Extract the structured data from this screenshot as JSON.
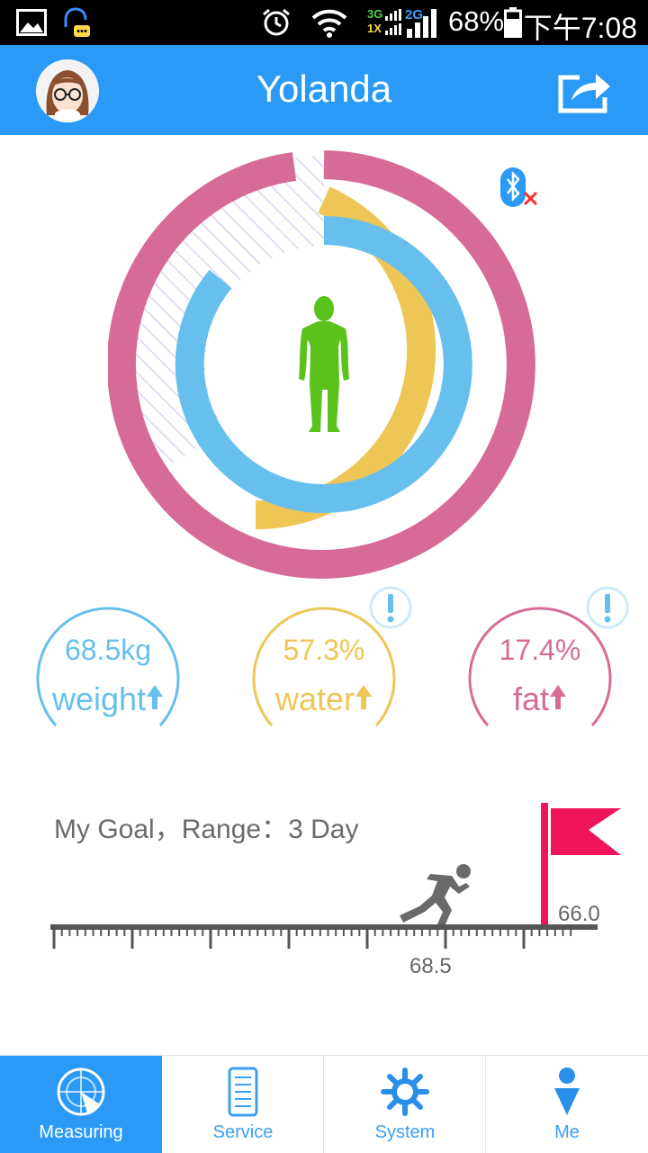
{
  "status_bar": {
    "battery": "68%",
    "time": "下午7:08",
    "network_3g": "3G",
    "network_1x": "1X",
    "network_2g": "2G"
  },
  "header": {
    "title": "Yolanda"
  },
  "metrics": [
    {
      "value": "68.5kg",
      "label": "weight",
      "color": "#67bfee"
    },
    {
      "value": "57.3%",
      "label": "water",
      "color": "#eec655"
    },
    {
      "value": "17.4%",
      "label": "fat",
      "color": "#d76b98"
    }
  ],
  "goal": {
    "title": "My Goal，Range：3 Day",
    "current": "68.5",
    "target": "66.0"
  },
  "colors": {
    "accent": "#2a9af6",
    "pink": "#d76b98",
    "yellow": "#eec655",
    "blue": "#67bfee",
    "body": "#5bc21c",
    "flag": "#f0145a"
  },
  "tabs": [
    {
      "label": "Measuring",
      "icon": "radar-icon",
      "active": true
    },
    {
      "label": "Service",
      "icon": "document-icon",
      "active": false
    },
    {
      "label": "System",
      "icon": "gear-icon",
      "active": false
    },
    {
      "label": "Me",
      "icon": "person-icon",
      "active": false
    }
  ]
}
